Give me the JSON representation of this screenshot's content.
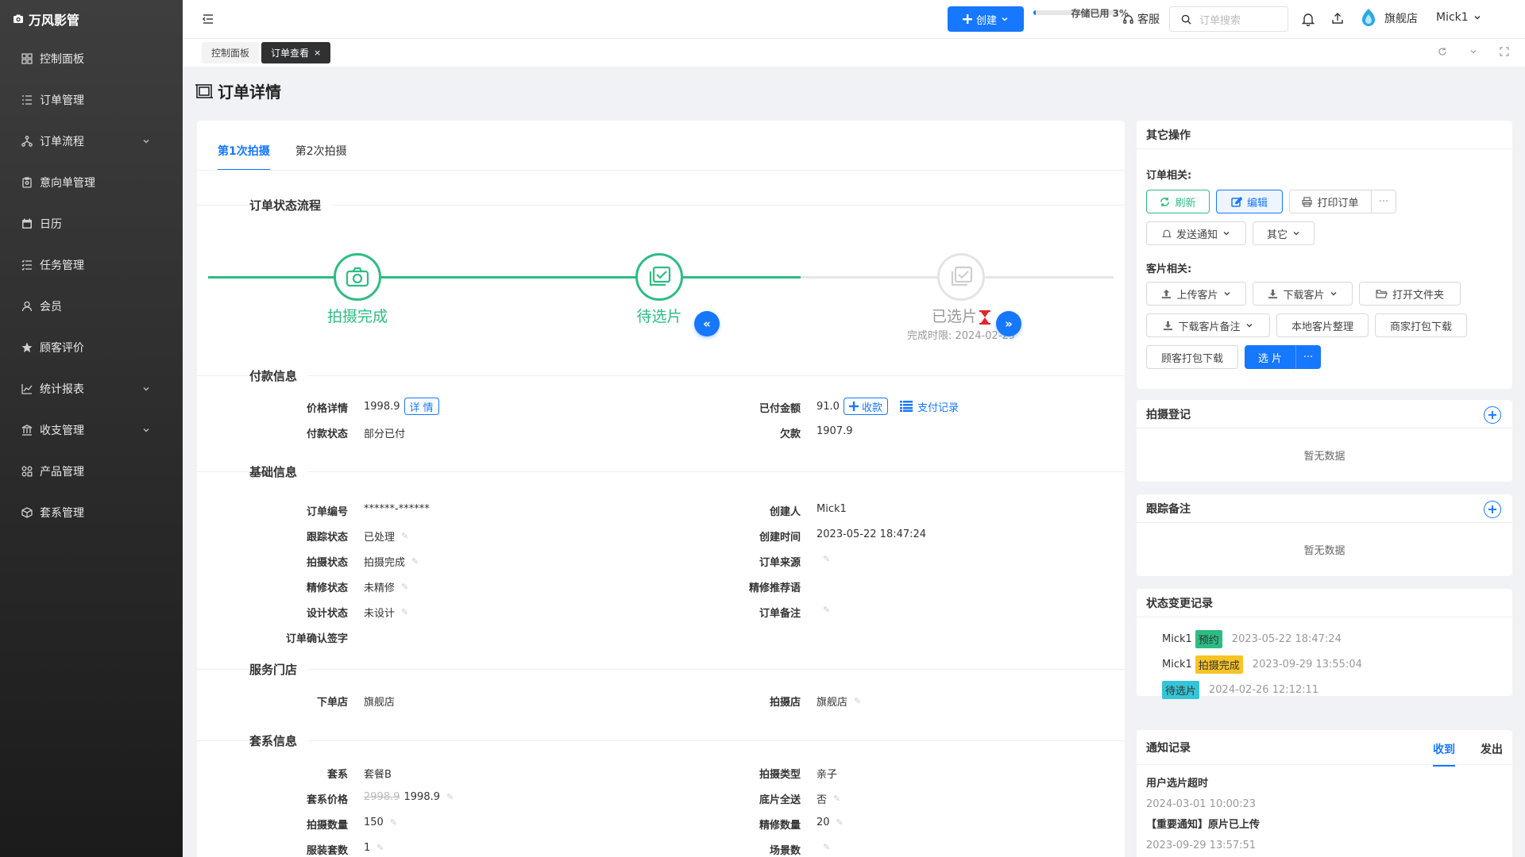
{
  "app": {
    "title": "万风影管"
  },
  "sidebar": {
    "items": [
      {
        "label": "控制面板",
        "icon": "dashboard-icon",
        "has_sub": false
      },
      {
        "label": "订单管理",
        "icon": "list-icon",
        "has_sub": false
      },
      {
        "label": "订单流程",
        "icon": "flow-icon",
        "has_sub": true
      },
      {
        "label": "意向单管理",
        "icon": "clipboard-icon",
        "has_sub": false
      },
      {
        "label": "日历",
        "icon": "calendar-icon",
        "has_sub": false
      },
      {
        "label": "任务管理",
        "icon": "task-list-icon",
        "has_sub": false
      },
      {
        "label": "会员",
        "icon": "user-icon",
        "has_sub": false
      },
      {
        "label": "顾客评价",
        "icon": "star-icon",
        "has_sub": false
      },
      {
        "label": "统计报表",
        "icon": "chart-icon",
        "has_sub": true
      },
      {
        "label": "收支管理",
        "icon": "bank-icon",
        "has_sub": true
      },
      {
        "label": "产品管理",
        "icon": "grid-icon",
        "has_sub": false
      },
      {
        "label": "套系管理",
        "icon": "package-icon",
        "has_sub": false
      }
    ]
  },
  "header": {
    "create_label": "创建",
    "storage_label": "存储已用 3%",
    "storage_percent": 3,
    "support_label": "客服",
    "search_placeholder": "订单搜索",
    "store_name": "旗舰店",
    "user_name": "Mick1"
  },
  "page_tabs": [
    {
      "label": "控制面板",
      "active": false
    },
    {
      "label": "订单查看",
      "active": true
    }
  ],
  "page_title": "订单详情",
  "shoot_tabs": [
    "第1次拍摄",
    "第2次拍摄"
  ],
  "sections": {
    "flow": "订单状态流程",
    "payment": "付款信息",
    "basic": "基础信息",
    "store": "服务门店",
    "package": "套系信息"
  },
  "flow": {
    "steps": [
      {
        "label": "拍摄完成",
        "icon": "camera-icon",
        "done": true
      },
      {
        "label": "待选片",
        "icon": "photo-check-icon",
        "done": true
      },
      {
        "label": "已选片",
        "icon": "photo-check-icon",
        "done": false,
        "deadline": "完成时限: 2024-02-29"
      }
    ],
    "prev_label": "«",
    "next_label": "»"
  },
  "payment": {
    "price_label": "价格详情",
    "price": "1998.9",
    "detail_btn": "详 情",
    "status_label": "付款状态",
    "status": "部分已付",
    "paid_label": "已付金额",
    "paid": "91.0",
    "collect_btn": "收款",
    "records_link": "支付记录",
    "owed_label": "欠款",
    "owed": "1907.9"
  },
  "basic": {
    "left": [
      {
        "label": "订单编号",
        "value": "******-******",
        "editable": false
      },
      {
        "label": "跟踪状态",
        "value": "已处理",
        "editable": true
      },
      {
        "label": "拍摄状态",
        "value": "拍摄完成",
        "editable": true
      },
      {
        "label": "精修状态",
        "value": "未精修",
        "editable": true
      },
      {
        "label": "设计状态",
        "value": "未设计",
        "editable": true
      },
      {
        "label": "订单确认签字",
        "value": "",
        "editable": false
      }
    ],
    "right": [
      {
        "label": "创建人",
        "value": "Mick1",
        "editable": false
      },
      {
        "label": "创建时间",
        "value": "2023-05-22 18:47:24",
        "editable": false
      },
      {
        "label": "订单来源",
        "value": "",
        "editable": true
      },
      {
        "label": "精修推荐语",
        "value": "",
        "editable": false
      },
      {
        "label": "订单备注",
        "value": "",
        "editable": true
      }
    ]
  },
  "store": {
    "order_store_label": "下单店",
    "order_store": "旗舰店",
    "shoot_store_label": "拍摄店",
    "shoot_store": "旗舰店"
  },
  "package": {
    "left": [
      {
        "label": "套系",
        "value": "套餐B",
        "editable": false
      },
      {
        "label": "套系价格",
        "old": "2998.9",
        "value": "1998.9",
        "editable": true
      },
      {
        "label": "拍摄数量",
        "value": "150",
        "editable": true
      },
      {
        "label": "服装套数",
        "value": "1",
        "editable": true
      }
    ],
    "right": [
      {
        "label": "拍摄类型",
        "value": "亲子",
        "editable": false
      },
      {
        "label": "底片全送",
        "value": "否",
        "editable": true
      },
      {
        "label": "精修数量",
        "value": "20",
        "editable": true
      },
      {
        "label": "场景数",
        "value": "",
        "editable": true
      }
    ]
  },
  "other_ops": {
    "title": "其它操作",
    "order_label": "订单相关:",
    "refresh": "刷新",
    "edit": "编辑",
    "print": "打印订单",
    "more": "···",
    "notify": "发送通知",
    "other": "其它",
    "photo_label": "客片相关:",
    "upload": "上传客片",
    "download": "下载客片",
    "open_folder": "打开文件夹",
    "download_notes": "下载客片备注",
    "local_organize": "本地客片整理",
    "merchant_pack": "商家打包下载",
    "customer_pack": "顾客打包下载",
    "select": "选 片",
    "select_more": "···"
  },
  "shoot_log": {
    "title": "拍摄登记",
    "empty": "暂无数据"
  },
  "follow_notes": {
    "title": "跟踪备注",
    "empty": "暂无数据"
  },
  "status_log": {
    "title": "状态变更记录",
    "entries": [
      {
        "user": "Mick1",
        "badge": "预约",
        "color": "#2dbd82",
        "time": "2023-05-22 18:47:24"
      },
      {
        "user": "Mick1",
        "badge": "拍摄完成",
        "color": "#f7c325",
        "time": "2023-09-29 13:55:04"
      },
      {
        "user": "",
        "badge": "待选片",
        "color": "#36c5d6",
        "time": "2024-02-26 12:12:11"
      }
    ]
  },
  "notices": {
    "title": "通知记录",
    "tab_received": "收到",
    "tab_sent": "发出",
    "items": [
      {
        "title": "用户选片超时",
        "time": "2024-03-01 10:00:23"
      },
      {
        "title": "【重要通知】原片已上传",
        "time": "2023-09-29 13:57:51"
      }
    ]
  },
  "colors": {
    "primary": "#1677ff",
    "success": "#2dbd82",
    "sidebar": "#2c2c2c"
  }
}
